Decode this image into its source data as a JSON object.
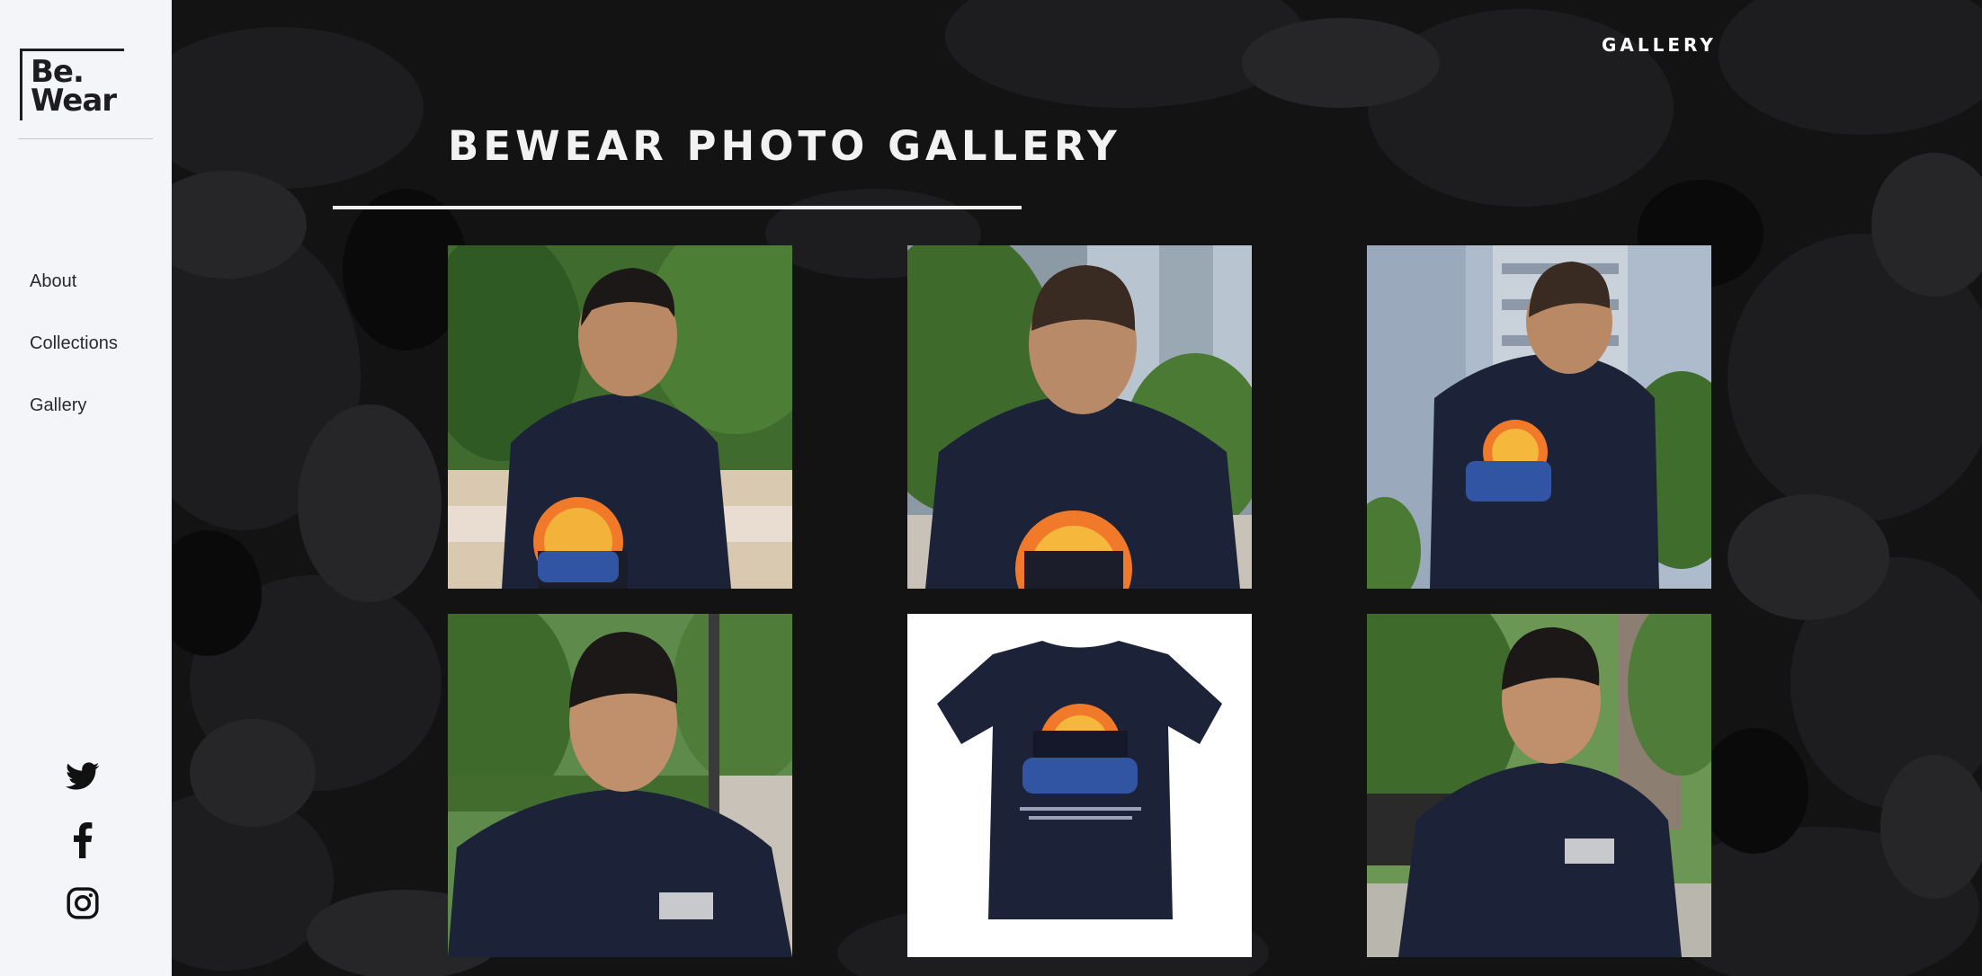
{
  "brand": {
    "logo_line1": "Be.",
    "logo_line2": "Wear"
  },
  "sidebar": {
    "nav": [
      {
        "label": "About"
      },
      {
        "label": "Collections"
      },
      {
        "label": "Gallery"
      }
    ],
    "social": [
      {
        "icon": "twitter-icon"
      },
      {
        "icon": "facebook-icon"
      },
      {
        "icon": "instagram-icon"
      }
    ]
  },
  "header": {
    "nav_link": "GALLERY"
  },
  "main": {
    "title": "BEWEAR PHOTO GALLERY",
    "photos": [
      {
        "subject": "man back view, green trees, navy tee with sunset city print"
      },
      {
        "subject": "man back view, trees and towers, navy tee with sunset print"
      },
      {
        "subject": "man turning, glass skyscraper, navy tee with car print"
      },
      {
        "subject": "man front portrait, park background, navy tee with logo"
      },
      {
        "subject": "product shot of navy tee back on white background"
      },
      {
        "subject": "man smiling sideways, trees, navy tee with logo"
      }
    ]
  },
  "colors": {
    "sidebar_bg": "#f4f5f9",
    "main_bg": "#121213",
    "tee_navy": "#1c2338",
    "text_light": "#f2f2f2"
  }
}
